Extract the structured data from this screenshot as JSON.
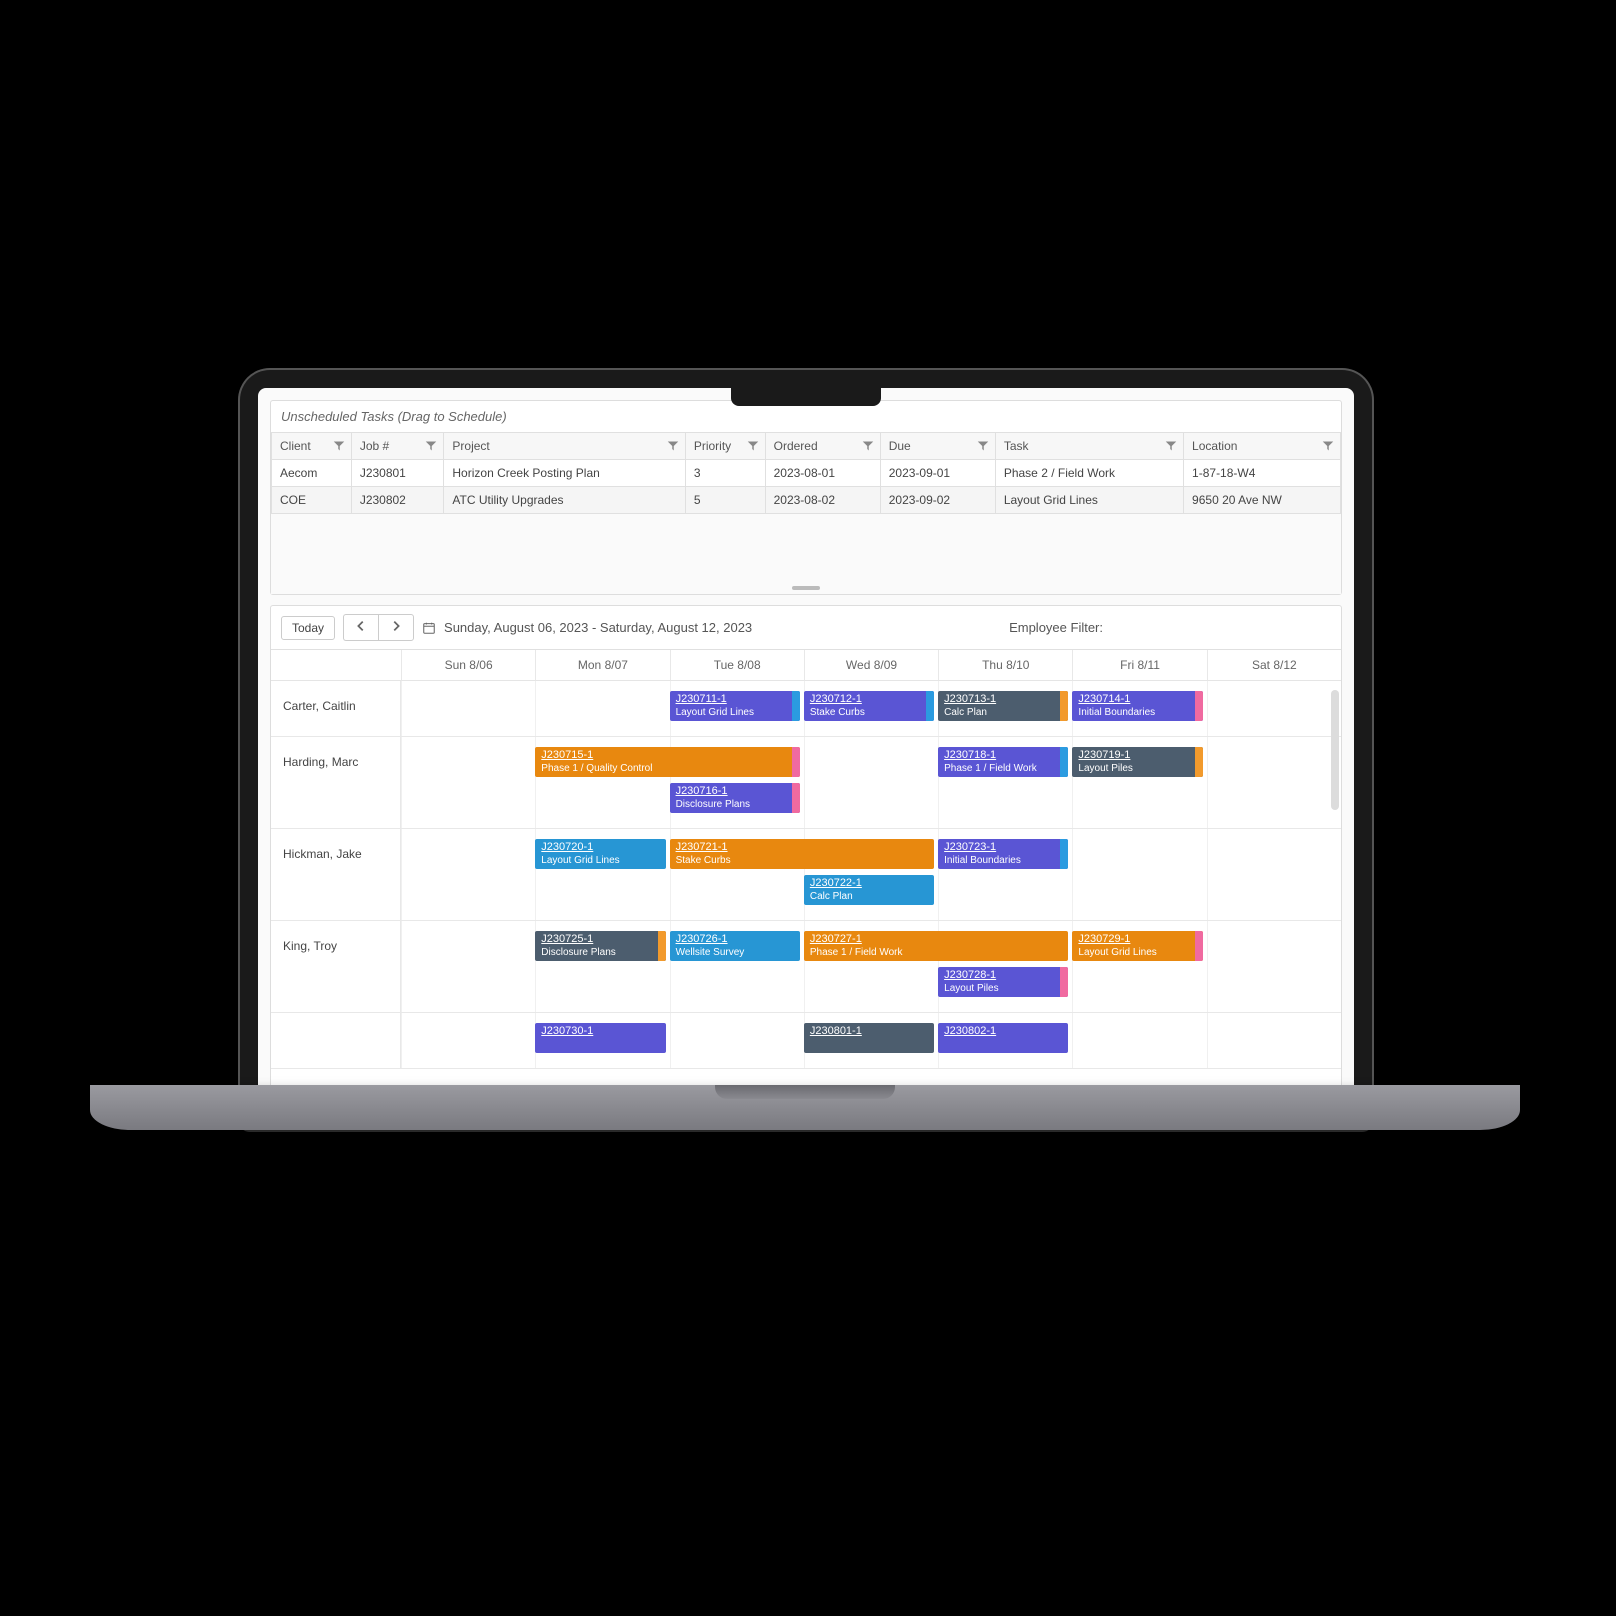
{
  "unscheduled": {
    "title": "Unscheduled Tasks (Drag to Schedule)",
    "columns": [
      "Client",
      "Job #",
      "Project",
      "Priority",
      "Ordered",
      "Due",
      "Task",
      "Location"
    ],
    "rows": [
      {
        "client": "Aecom",
        "job": "J230801",
        "project": "Horizon Creek Posting Plan",
        "priority": "3",
        "ordered": "2023-08-01",
        "due": "2023-09-01",
        "task": "Phase 2 / Field Work",
        "location": "1-87-18-W4"
      },
      {
        "client": "COE",
        "job": "J230802",
        "project": "ATC Utility Upgrades",
        "priority": "5",
        "ordered": "2023-08-02",
        "due": "2023-09-02",
        "task": "Layout Grid Lines",
        "location": "9650 20 Ave NW"
      }
    ]
  },
  "toolbar": {
    "today": "Today",
    "date_range": "Sunday, August 06, 2023 - Saturday, August 12, 2023",
    "employee_filter_label": "Employee Filter:"
  },
  "days": [
    "Sun 8/06",
    "Mon 8/07",
    "Tue 8/08",
    "Wed 8/09",
    "Thu 8/10",
    "Fri 8/11",
    "Sat 8/12"
  ],
  "employees": [
    {
      "name": "Carter, Caitlin",
      "tasks": [
        {
          "job": "J230711-1",
          "desc": "Layout Grid Lines",
          "day_start": 2,
          "span": 1,
          "row": 0,
          "color": "purple",
          "stripe": "blue"
        },
        {
          "job": "J230712-1",
          "desc": "Stake Curbs",
          "day_start": 3,
          "span": 1,
          "row": 0,
          "color": "purple",
          "stripe": "blue"
        },
        {
          "job": "J230713-1",
          "desc": "Calc Plan",
          "day_start": 4,
          "span": 1,
          "row": 0,
          "color": "slate",
          "stripe": "orange"
        },
        {
          "job": "J230714-1",
          "desc": "Initial Boundaries",
          "day_start": 5,
          "span": 1,
          "row": 0,
          "color": "purple",
          "stripe": "pink"
        }
      ]
    },
    {
      "name": "Harding, Marc",
      "tasks": [
        {
          "job": "J230715-1",
          "desc": "Phase 1 / Quality Control",
          "day_start": 1,
          "span": 2,
          "row": 0,
          "color": "orange",
          "stripe": "pink"
        },
        {
          "job": "J230716-1",
          "desc": "Disclosure Plans",
          "day_start": 2,
          "span": 1,
          "row": 1,
          "color": "purple",
          "stripe": "pink"
        },
        {
          "job": "J230718-1",
          "desc": "Phase 1 / Field Work",
          "day_start": 4,
          "span": 1,
          "row": 0,
          "color": "purple",
          "stripe": "blue"
        },
        {
          "job": "J230719-1",
          "desc": "Layout Piles",
          "day_start": 5,
          "span": 1,
          "row": 0,
          "color": "slate",
          "stripe": "orange"
        }
      ]
    },
    {
      "name": "Hickman, Jake",
      "tasks": [
        {
          "job": "J230720-1",
          "desc": "Layout Grid Lines",
          "day_start": 1,
          "span": 1,
          "row": 0,
          "color": "blue",
          "stripe": ""
        },
        {
          "job": "J230721-1",
          "desc": "Stake Curbs",
          "day_start": 2,
          "span": 2,
          "row": 0,
          "color": "orange",
          "stripe": ""
        },
        {
          "job": "J230722-1",
          "desc": "Calc Plan",
          "day_start": 3,
          "span": 1,
          "row": 1,
          "color": "blue",
          "stripe": ""
        },
        {
          "job": "J230723-1",
          "desc": "Initial Boundaries",
          "day_start": 4,
          "span": 1,
          "row": 0,
          "color": "purple",
          "stripe": "blue"
        }
      ]
    },
    {
      "name": "King, Troy",
      "tasks": [
        {
          "job": "J230725-1",
          "desc": "Disclosure Plans",
          "day_start": 1,
          "span": 1,
          "row": 0,
          "color": "slate",
          "stripe": "orange"
        },
        {
          "job": "J230726-1",
          "desc": "Wellsite Survey",
          "day_start": 2,
          "span": 1,
          "row": 0,
          "color": "blue",
          "stripe": ""
        },
        {
          "job": "J230727-1",
          "desc": "Phase 1 / Field Work",
          "day_start": 3,
          "span": 2,
          "row": 0,
          "color": "orange",
          "stripe": ""
        },
        {
          "job": "J230728-1",
          "desc": "Layout Piles",
          "day_start": 4,
          "span": 1,
          "row": 1,
          "color": "purple",
          "stripe": "pink"
        },
        {
          "job": "J230729-1",
          "desc": "Layout Grid Lines",
          "day_start": 5,
          "span": 1,
          "row": 0,
          "color": "orange",
          "stripe": "pink"
        }
      ]
    },
    {
      "name": "",
      "tasks": [
        {
          "job": "J230730-1",
          "desc": "",
          "day_start": 1,
          "span": 1,
          "row": 0,
          "color": "purple",
          "stripe": ""
        },
        {
          "job": "J230801-1",
          "desc": "",
          "day_start": 3,
          "span": 1,
          "row": 0,
          "color": "slate",
          "stripe": ""
        },
        {
          "job": "J230802-1",
          "desc": "",
          "day_start": 4,
          "span": 1,
          "row": 0,
          "color": "purple",
          "stripe": ""
        }
      ]
    }
  ]
}
